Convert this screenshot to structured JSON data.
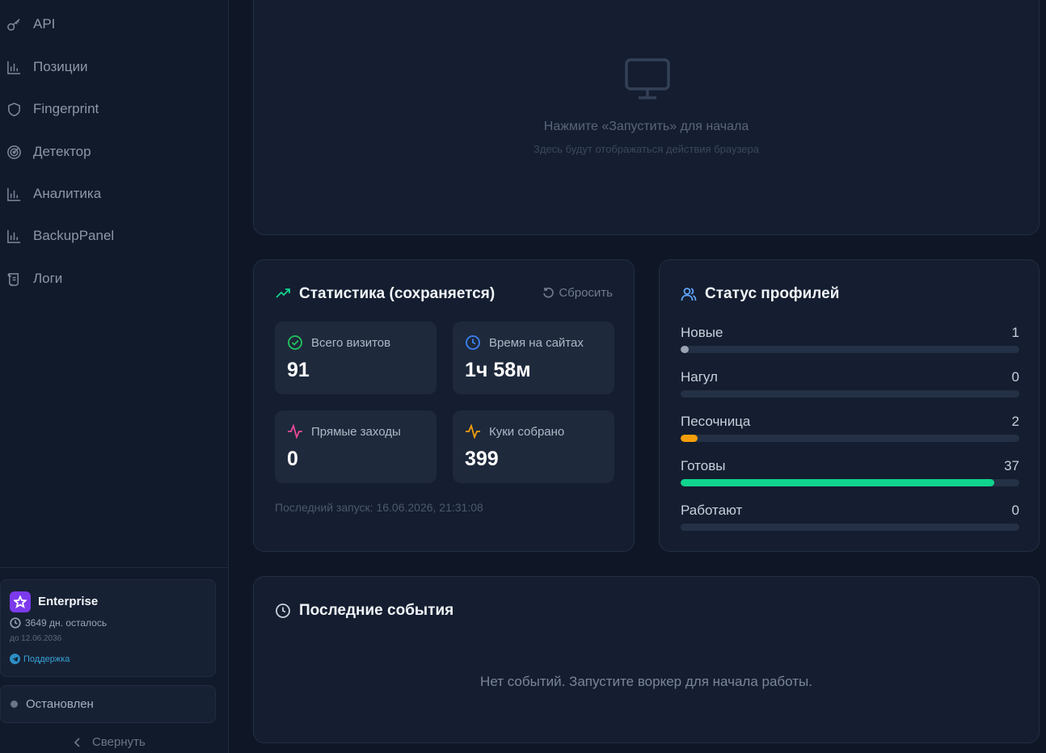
{
  "sidebar": {
    "items": [
      {
        "label": "API",
        "icon": "key-icon"
      },
      {
        "label": "Позиции",
        "icon": "bar-chart-icon"
      },
      {
        "label": "Fingerprint",
        "icon": "shield-icon"
      },
      {
        "label": "Детектор",
        "icon": "radar-icon"
      },
      {
        "label": "Аналитика",
        "icon": "bar-chart-icon"
      },
      {
        "label": "BackupPanel",
        "icon": "bar-chart-icon"
      },
      {
        "label": "Логи",
        "icon": "scroll-icon"
      }
    ],
    "plan": {
      "name": "Enterprise",
      "days_left": "3649 дн. осталось",
      "until": "до 12.06.2036",
      "support": "Поддержка"
    },
    "status": "Остановлен",
    "collapse": "Свернуть"
  },
  "browser": {
    "hint": "Нажмите «Запустить» для начала",
    "sub": "Здесь будут отображаться действия браузера"
  },
  "stats": {
    "title": "Статистика (сохраняется)",
    "reset": "Сбросить",
    "metrics": [
      {
        "label": "Всего визитов",
        "value": "91",
        "color": "#22c55e"
      },
      {
        "label": "Время на сайтах",
        "value": "1ч 58м",
        "color": "#3b82f6"
      },
      {
        "label": "Прямые заходы",
        "value": "0",
        "color": "#ec4899"
      },
      {
        "label": "Куки собрано",
        "value": "399",
        "color": "#f59e0b"
      }
    ],
    "last_run": "Последний запуск: 16.06.2026, 21:31:08"
  },
  "profiles": {
    "title": "Статус профилей",
    "rows": [
      {
        "label": "Новые",
        "count": "1",
        "fraction": 0.025,
        "color": "#9aa4b3"
      },
      {
        "label": "Нагул",
        "count": "0",
        "fraction": 0,
        "color": "#9aa4b3"
      },
      {
        "label": "Песочница",
        "count": "2",
        "fraction": 0.05,
        "color": "#f59e0b"
      },
      {
        "label": "Готовы",
        "count": "37",
        "fraction": 0.925,
        "color": "#10d48e"
      },
      {
        "label": "Работают",
        "count": "0",
        "fraction": 0,
        "color": "#9aa4b3"
      }
    ]
  },
  "events": {
    "title": "Последние события",
    "empty": "Нет событий. Запустите воркер для начала работы."
  }
}
